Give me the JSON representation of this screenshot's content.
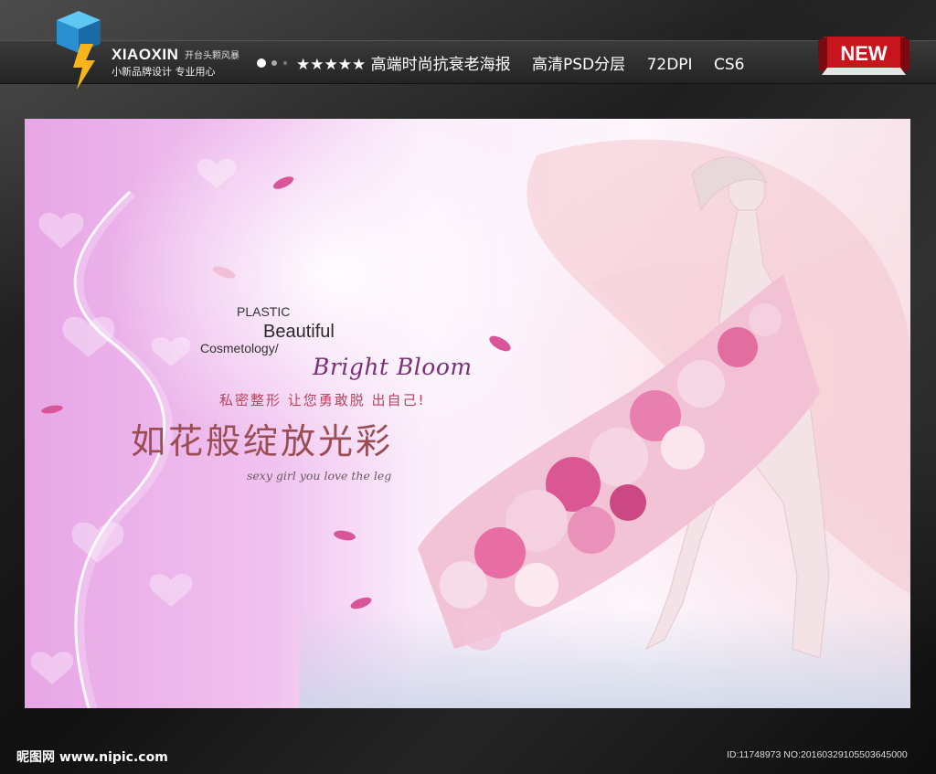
{
  "header": {
    "brand_name": "XIAOXIN",
    "brand_sub_1": "开台头颗风暴",
    "brand_sub_2": "小新品牌设计  专业用心",
    "tagline_items": [
      "★★★★★ 高端时尚抗衰老海报",
      "高清PSD分层",
      "72DPI",
      "CS6"
    ],
    "badge": "NEW"
  },
  "poster": {
    "plastic": "PLASTIC",
    "beautiful": "Beautiful",
    "cosmetology": "Cosmetology/",
    "bright_bloom": "Bright Bloom",
    "slogan": "私密整形 让您勇敢脱 出自己!",
    "headline": "如花般绽放光彩",
    "script_line": "sexy girl  you love the leg"
  },
  "footer": {
    "site": "昵图网 www.nipic.com",
    "id_line": "ID:11748973 NO:20160329105503645000"
  },
  "colors": {
    "poster_pink": "#e7a6e6",
    "headline": "#9a4d55",
    "bright_bloom": "#7b2e7a",
    "badge_red": "#c8141c"
  }
}
